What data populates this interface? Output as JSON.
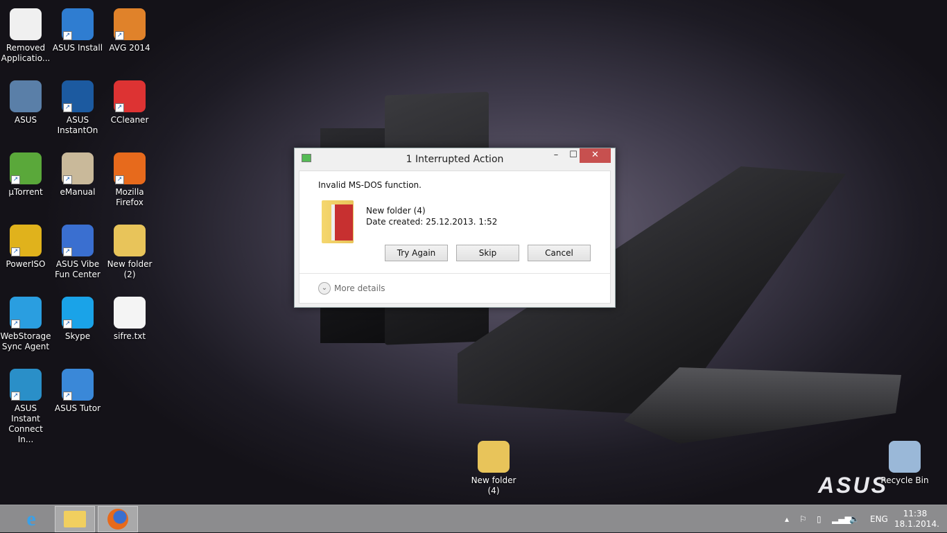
{
  "desktop": {
    "icons": [
      {
        "label": "Removed Applicatio...",
        "color": "#f0f0f0"
      },
      {
        "label": "ASUS Install",
        "color": "#2f7dd1"
      },
      {
        "label": "AVG 2014",
        "color": "#e0822a"
      },
      {
        "label": "ASUS",
        "color": "#5a7fa8"
      },
      {
        "label": "ASUS InstantOn",
        "color": "#1c5aa0"
      },
      {
        "label": "CCleaner",
        "color": "#d33"
      },
      {
        "label": "µTorrent",
        "color": "#5aa83a"
      },
      {
        "label": "eManual",
        "color": "#c9b99a"
      },
      {
        "label": "Mozilla Firefox",
        "color": "#e76a1c"
      },
      {
        "label": "PowerISO",
        "color": "#e0b21c"
      },
      {
        "label": "ASUS Vibe Fun Center",
        "color": "#3a6fd0"
      },
      {
        "label": "New folder (2)",
        "color": "#e8c45a"
      },
      {
        "label": "WebStorage Sync Agent",
        "color": "#2a9ee0"
      },
      {
        "label": "Skype",
        "color": "#1aa3e8"
      },
      {
        "label": "sifre.txt",
        "color": "#f4f4f4"
      },
      {
        "label": "ASUS Instant Connect In...",
        "color": "#2a8fc8"
      },
      {
        "label": "ASUS Tutor",
        "color": "#3a88d8"
      },
      {
        "label": "New folder (4)",
        "color": "#e8c45a"
      },
      {
        "label": "Recycle Bin",
        "color": "#9ab8d8"
      }
    ],
    "brand": "ASUS"
  },
  "dialog": {
    "title": "1 Interrupted Action",
    "error": "Invalid MS-DOS function.",
    "item_name": "New folder (4)",
    "item_date": "Date created: 25.12.2013. 1:52",
    "buttons": [
      "Try Again",
      "Skip",
      "Cancel"
    ],
    "more_details": "More details",
    "minimize": "–",
    "maximize": "☐",
    "close": "✕"
  },
  "taskbar": {
    "language": "ENG",
    "time": "11:38",
    "date": "18.1.2014."
  }
}
